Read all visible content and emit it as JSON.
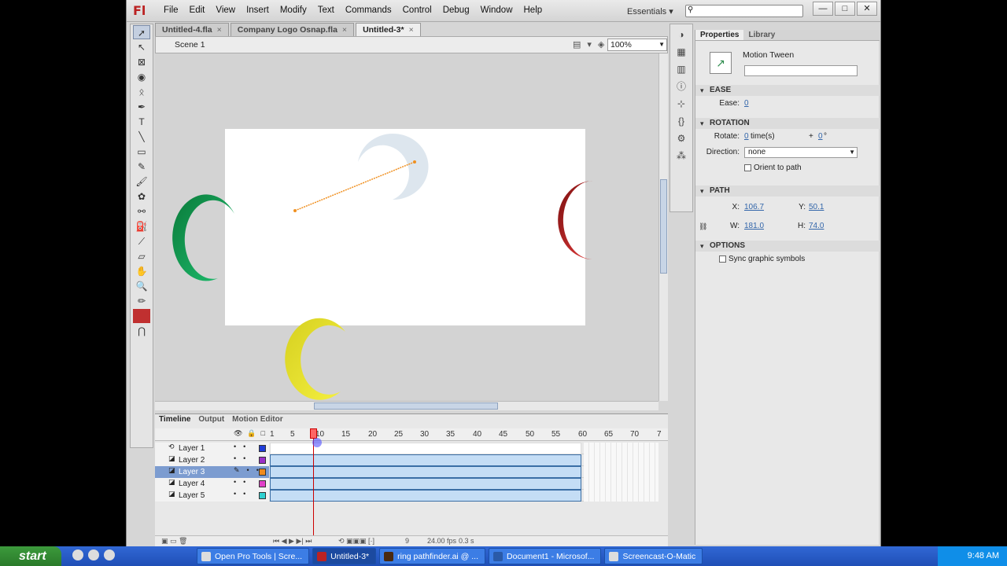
{
  "app": {
    "logo": "Fl",
    "workspace": "Essentials ▾"
  },
  "menu": [
    "File",
    "Edit",
    "View",
    "Insert",
    "Modify",
    "Text",
    "Commands",
    "Control",
    "Debug",
    "Window",
    "Help"
  ],
  "doc_tabs": [
    {
      "label": "Untitled-4.fla",
      "close": "×",
      "active": false
    },
    {
      "label": "Company Logo Osnap.fla",
      "close": "×",
      "active": false
    },
    {
      "label": "Untitled-3*",
      "close": "×",
      "active": true
    }
  ],
  "editbar": {
    "scene": "Scene 1",
    "zoom": "100%"
  },
  "timeline": {
    "tabs": [
      "Timeline",
      "Output",
      "Motion Editor"
    ],
    "frame_numbers": [
      "1",
      "5",
      "10",
      "15",
      "20",
      "25",
      "30",
      "35",
      "40",
      "45",
      "50",
      "55",
      "60",
      "65",
      "70",
      "7"
    ],
    "layers": [
      {
        "name": "Layer 1",
        "color": "#1e3cd8",
        "selected": false,
        "tween": false
      },
      {
        "name": "Layer 2",
        "color": "#9b30c8",
        "selected": false,
        "tween": true
      },
      {
        "name": "Layer 3",
        "color": "#f08a1c",
        "selected": true,
        "tween": true
      },
      {
        "name": "Layer 4",
        "color": "#e040c8",
        "selected": false,
        "tween": true
      },
      {
        "name": "Layer 5",
        "color": "#30d0d0",
        "selected": false,
        "tween": true
      }
    ],
    "footer": {
      "frame": "9",
      "fps": "24.00 fps",
      "time": "0.3 s"
    }
  },
  "properties": {
    "tabs": [
      "Properties",
      "Library"
    ],
    "type_label": "Motion Tween",
    "instance_name": "",
    "ease": {
      "heading": "EASE",
      "label": "Ease:",
      "value": "0"
    },
    "rotation": {
      "heading": "ROTATION",
      "rotate_label": "Rotate:",
      "times_value": "0",
      "times_suffix": "time(s)",
      "plus": "+",
      "degrees_value": "0",
      "degrees_suffix": "°",
      "direction_label": "Direction:",
      "direction_value": "none",
      "orient_label": "Orient to path"
    },
    "path": {
      "heading": "PATH",
      "x_label": "X:",
      "x_value": "106.7",
      "y_label": "Y:",
      "y_value": "50.1",
      "w_label": "W:",
      "w_value": "181.0",
      "h_label": "H:",
      "h_value": "74.0"
    },
    "options": {
      "heading": "OPTIONS",
      "sync_label": "Sync graphic symbols"
    }
  },
  "taskbar": {
    "start": "start",
    "tasks": [
      {
        "label": "Open Pro Tools | Scre...",
        "active": false
      },
      {
        "label": "Untitled-3*",
        "active": true
      },
      {
        "label": "ring pathfinder.ai @ ...",
        "active": false
      },
      {
        "label": "Document1 - Microsof...",
        "active": false
      },
      {
        "label": "Screencast-O-Matic",
        "active": false
      }
    ],
    "clock": "9:48 AM"
  }
}
